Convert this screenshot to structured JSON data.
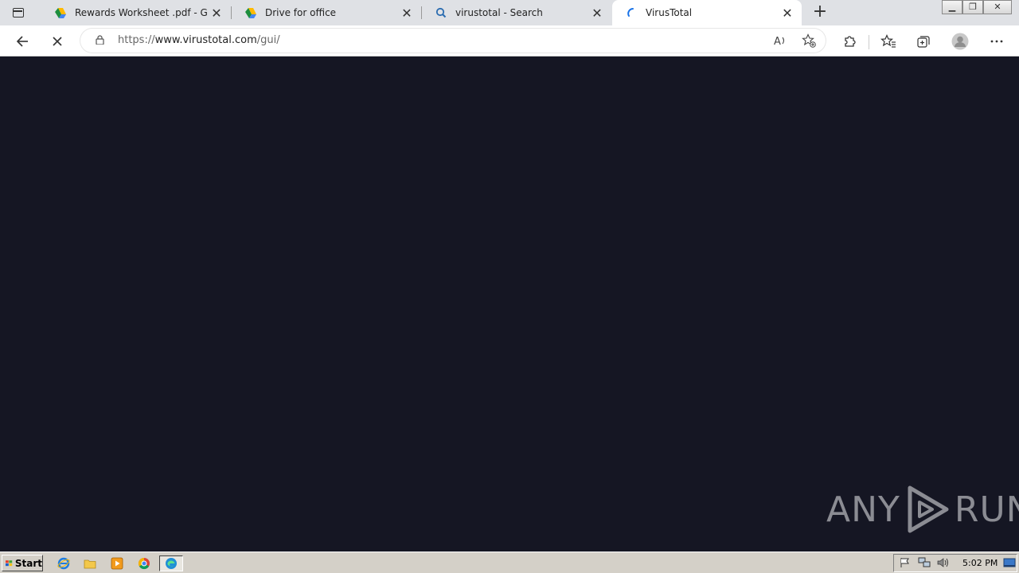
{
  "tabs": [
    {
      "title": "Rewards Worksheet .pdf - Goog",
      "favicon": "google-drive-icon",
      "active": false
    },
    {
      "title": "Drive for office",
      "favicon": "google-drive-icon",
      "active": false
    },
    {
      "title": "virustotal - Search",
      "favicon": "search-icon",
      "active": false
    },
    {
      "title": "VirusTotal",
      "favicon": "virustotal-loading-icon",
      "active": true
    }
  ],
  "tab_close_glyph": "✕",
  "new_tab_glyph": "+",
  "window_controls": {
    "minimize": "▁",
    "restore": "❐",
    "close": "✕"
  },
  "address": {
    "prefix": "https://",
    "host": "www.virustotal.com",
    "path": "/gui/"
  },
  "watermark": {
    "left": "ANY",
    "right": "RUN"
  },
  "taskbar": {
    "start_label": "Start",
    "clock": "5:02 PM"
  },
  "colors": {
    "page_background": "#151623",
    "tabbar": "#dfe1e5",
    "taskbar": "#d4d0c8"
  }
}
